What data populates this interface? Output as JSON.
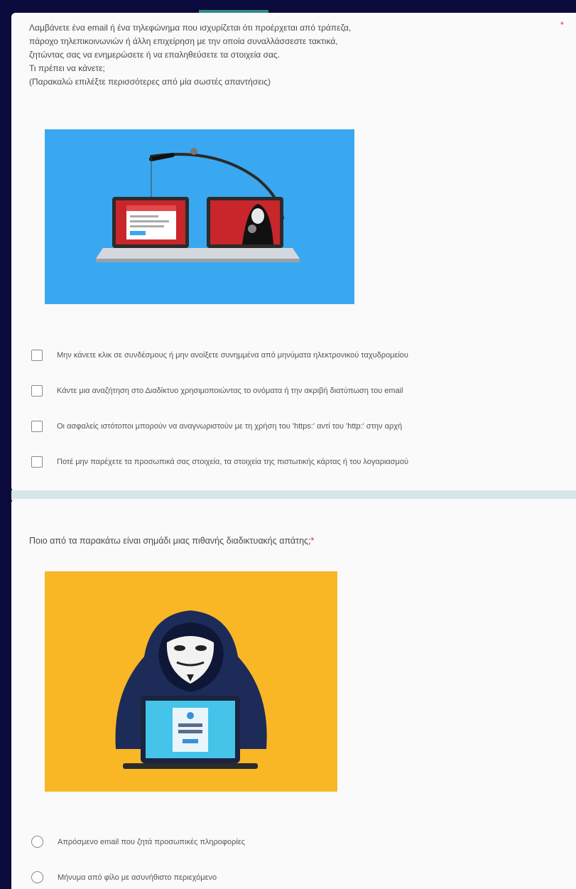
{
  "q1": {
    "lines": [
      "Λαμβάνετε ένα email ή ένα τηλεφώνημα που ισχυρίζεται ότι προέρχεται από τράπεζα,",
      "πάροχο τηλεπικοινωνιών ή άλλη επιχείρηση με την οποία συναλλάσσεστε τακτικά,",
      "ζητώντας σας να ενημερώσετε ή να επαληθεύσετε τα στοιχεία σας.",
      "Τι πρέπει να κάνετε;",
      "(Παρακαλώ επιλέξτε περισσότερες από μία σωστές απαντήσεις)"
    ],
    "required_mark": "*",
    "options": [
      "Μην κάνετε κλικ σε συνδέσμους ή μην ανοίξετε συνημμένα από μηνύματα ηλεκτρονικού ταχυδρομείου",
      "Κάντε μια αναζήτηση στο Διαδίκτυο χρησιμοποιώντας το ονόματα ή την ακριβή διατύπωση του email",
      "Οι ασφαλείς ιστότοποι μπορούν να αναγνωριστούν με τη χρήση του 'https:' αντί του 'http:' στην αρχή",
      "Ποτέ μην παρέχετε τα προσωπικά σας στοιχεία, τα στοιχεία της πιστωτικής κάρτας ή του λογαριασμού"
    ]
  },
  "q2": {
    "title": "Ποιο από τα παρακάτω είναι σημάδι μιας πιθανής διαδικτυακής απάτης;",
    "required_mark": "*",
    "options": [
      "Απρόσμενο email που ζητά προσωπικές πληροφορίες",
      "Μήνυμα από φίλο με ασυνήθιστο περιεχόμενο"
    ]
  },
  "colors": {
    "page_background": "#0b0a3c",
    "card_background": "#fafafa",
    "accent": "#2f8a86",
    "required": "#d93025",
    "phishing_image_background": "#3aa8f0",
    "hacker_image_background": "#f9b726"
  },
  "images": {
    "q1_image": "phishing-laptops-illustration",
    "q2_image": "hooded-hacker-laptop-illustration"
  }
}
